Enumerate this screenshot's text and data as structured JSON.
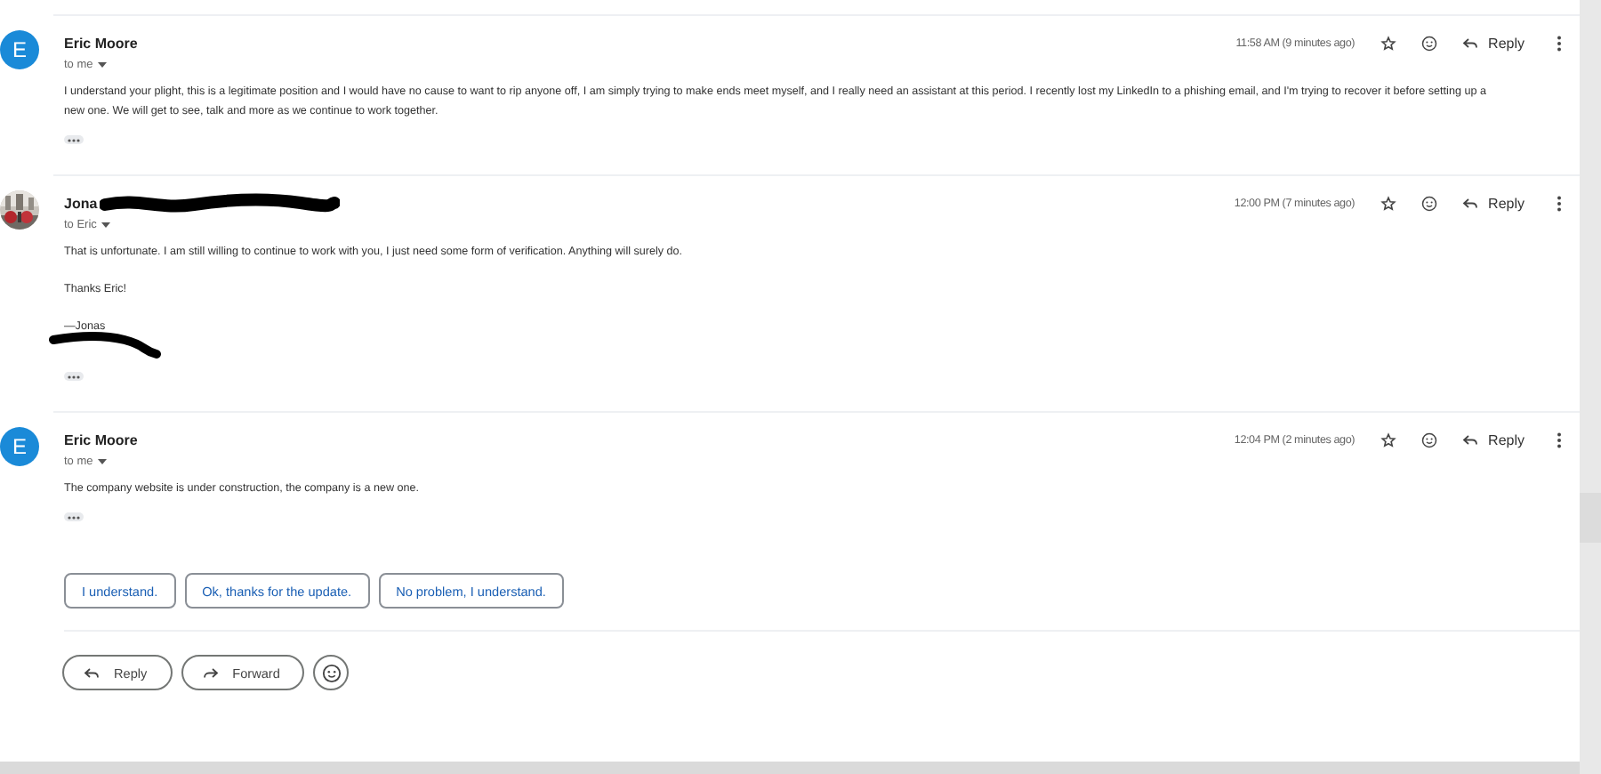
{
  "messages": [
    {
      "avatar": {
        "kind": "letter",
        "letter": "E"
      },
      "sender": "Eric Moore",
      "sender_redacted": false,
      "recipient": "to me",
      "time": "11:58 AM (9 minutes ago)",
      "reply": "Reply",
      "paragraphs": [
        {
          "text": "I understand your plight, this is a legitimate position and I would have no cause to want to rip anyone off, I am simply trying to make ends meet myself, and I really need an assistant at this period. I recently lost my LinkedIn to a phishing email, and I'm trying to recover it before setting up a new one. We will get to see, talk and more as we continue to work together.",
          "redacted": false
        }
      ]
    },
    {
      "sender": "Jona",
      "sender_redacted": true,
      "recipient": "to Eric",
      "time": "12:00 PM (7 minutes ago)",
      "reply": "Reply",
      "paragraphs": [
        {
          "text": "That is unfortunate. I am still willing to continue to work with you, I just need some form of verification. Anything will surely do.",
          "redacted": false
        },
        {
          "text": "Thanks Eric!",
          "redacted": false
        },
        {
          "text": "—Jonas",
          "redacted": true
        }
      ]
    },
    {
      "avatar": {
        "kind": "letter",
        "letter": "E"
      },
      "sender": "Eric Moore",
      "sender_redacted": false,
      "recipient": "to me",
      "time": "12:04 PM (2 minutes ago)",
      "reply": "Reply",
      "paragraphs": [
        {
          "text": "The company website is under construction, the company is a new one.",
          "redacted": false
        }
      ]
    }
  ],
  "smart_replies": [
    "I understand.",
    "Ok, thanks for the update.",
    "No problem, I understand."
  ],
  "actions": [
    {
      "kind": "reply",
      "label": "Reply"
    },
    {
      "kind": "forward",
      "label": "Forward"
    },
    {
      "kind": "emoji"
    }
  ]
}
